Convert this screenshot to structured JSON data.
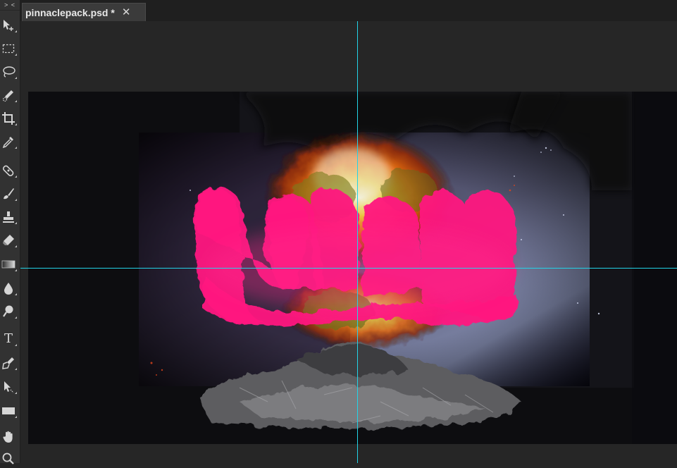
{
  "toolbar": {
    "collapse_label": "> <",
    "tools": [
      {
        "name": "move-tool",
        "icon": "move-icon"
      },
      {
        "name": "marquee-tool",
        "icon": "marquee-icon"
      },
      {
        "name": "lasso-tool",
        "icon": "lasso-icon"
      },
      {
        "name": "quick-selection-tool",
        "icon": "quick-selection-icon"
      },
      {
        "name": "crop-tool",
        "icon": "crop-icon"
      },
      {
        "name": "eyedropper-tool",
        "icon": "eyedropper-icon"
      },
      {
        "name": "healing-brush-tool",
        "icon": "bandage-icon"
      },
      {
        "name": "brush-tool",
        "icon": "brush-icon"
      },
      {
        "name": "clone-stamp-tool",
        "icon": "stamp-icon"
      },
      {
        "name": "eraser-tool",
        "icon": "eraser-icon"
      },
      {
        "name": "gradient-tool",
        "icon": "gradient-icon"
      },
      {
        "name": "blur-tool",
        "icon": "drop-icon"
      },
      {
        "name": "dodge-tool",
        "icon": "dodge-icon"
      },
      {
        "name": "type-tool",
        "icon": "type-icon",
        "glyph": "T"
      },
      {
        "name": "pen-tool",
        "icon": "pen-icon"
      },
      {
        "name": "path-selection-tool",
        "icon": "path-selection-icon"
      },
      {
        "name": "rectangle-tool",
        "icon": "rectangle-icon"
      },
      {
        "name": "hand-tool",
        "icon": "hand-icon"
      },
      {
        "name": "zoom-tool",
        "icon": "zoom-icon"
      }
    ]
  },
  "document": {
    "tab_title": "pinnaclepack.psd *",
    "close_glyph": "✕"
  },
  "colors": {
    "guide": "#22d4e8",
    "accent_pink": "#ff1580",
    "panel": "#323232",
    "workspace": "#262626"
  }
}
